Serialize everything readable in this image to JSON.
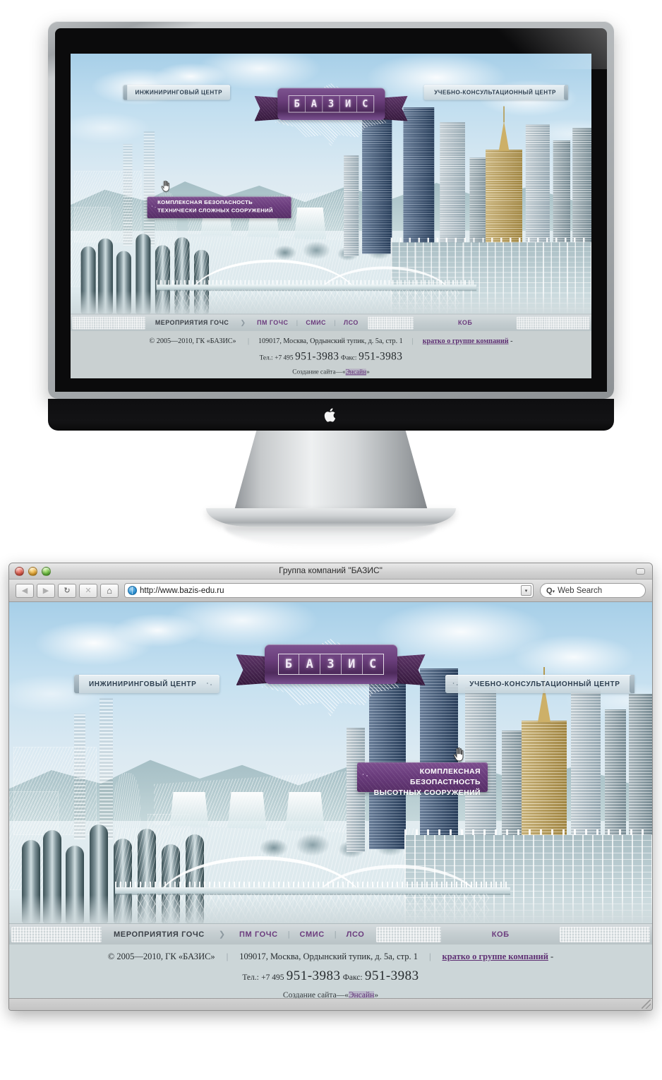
{
  "browser": {
    "window_title": "Группа компаний \"БАЗИС\"",
    "url": "http://www.bazis-edu.ru",
    "search_placeholder": "Web Search",
    "back_icon": "◀",
    "forward_icon": "▶",
    "reload_icon": "↻",
    "stop_icon": "✕",
    "home_icon": "⌂",
    "search_icon": "Q",
    "dropdown_icon": "▾"
  },
  "site": {
    "logo_letters": [
      "Б",
      "А",
      "З",
      "И",
      "С"
    ],
    "tab_left": "ИНЖИНИРИНГОВЫЙ ЦЕНТР",
    "tab_right": "УЧЕБНО-КОНСУЛЬТАЦИОННЫЙ ЦЕНТР",
    "callout_line1": "КОМПЛЕКСНАЯ БЕЗОПАСТНОСТЬ",
    "callout_line2": "ВЫСОТНЫХ СООРУЖЕНИЙ",
    "callout_alt_line1": "КОМПЛЕКСНАЯ БЕЗОПАСНОСТЬ",
    "callout_alt_line2": "ТЕХНИЧЕСКИ СЛОЖНЫХ СООРУЖЕНИЙ",
    "nav": {
      "item1": "МЕРОПРИЯТИЯ ГОЧС",
      "arrow": "❯",
      "item2": "ПМ ГОЧС",
      "sep": "|",
      "item3": "СМИС",
      "item4": "ЛСО",
      "item5": "КОБ"
    },
    "footer": {
      "copyright": "© 2005—2010, ГК «БАЗИС»",
      "address": "109017,  Москва, Ордынский тупик, д. 5а, стр. 1",
      "brief_link": "кратко о группе компаний",
      "brief_suffix": "-",
      "phone_label": "Тел.:",
      "phone_code": "+7 495",
      "phone_number": "951-3983",
      "fax_label": "Факс:",
      "fax_number": "951-3983",
      "credit_prefix": "Создание сайта—«",
      "credit_link": "Энсайн",
      "credit_suffix": "»"
    }
  },
  "colors": {
    "purple": "#6a3c7c",
    "purple_dark": "#46254f",
    "nav_purple": "#6b3b7d",
    "page_bg": "#ccd6d8",
    "sky": "#a7cfe8",
    "gold": "#c9ad64",
    "blue_tower": "#3a5b86"
  },
  "device": {
    "brand_icon": "apple-logo"
  }
}
